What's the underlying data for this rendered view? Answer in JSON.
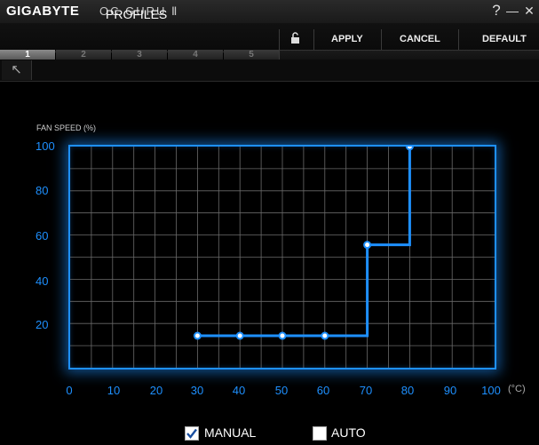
{
  "titlebar": {
    "brand": "GIGABYTE",
    "app": "OC GURU Ⅱ",
    "help": "?",
    "minimize": "—",
    "close": "✕"
  },
  "header": {
    "title": "PROFILES",
    "apply": "APPLY",
    "cancel": "CANCEL",
    "default": "DEFAULT"
  },
  "tabs": [
    "1",
    "2",
    "3",
    "4",
    "5"
  ],
  "active_tab": "1",
  "chart_data": {
    "type": "line",
    "ylabel": "FAN SPEED (%)",
    "xunit": "(°C)",
    "xlim": [
      0,
      100
    ],
    "ylim": [
      10,
      100
    ],
    "x_ticks": [
      "0",
      "10",
      "20",
      "30",
      "40",
      "50",
      "60",
      "70",
      "80",
      "90",
      "100"
    ],
    "y_ticks": [
      "100",
      "80",
      "60",
      "40",
      "20"
    ],
    "points": [
      {
        "x": 30,
        "y": 23
      },
      {
        "x": 40,
        "y": 23
      },
      {
        "x": 50,
        "y": 23
      },
      {
        "x": 60,
        "y": 23
      },
      {
        "x": 70,
        "y": 60
      },
      {
        "x": 80,
        "y": 100
      }
    ],
    "step": true,
    "grid": true,
    "line_color": "#1e90ff"
  },
  "options": {
    "manual": "MANUAL",
    "auto": "AUTO",
    "manual_checked": true,
    "auto_checked": false
  }
}
